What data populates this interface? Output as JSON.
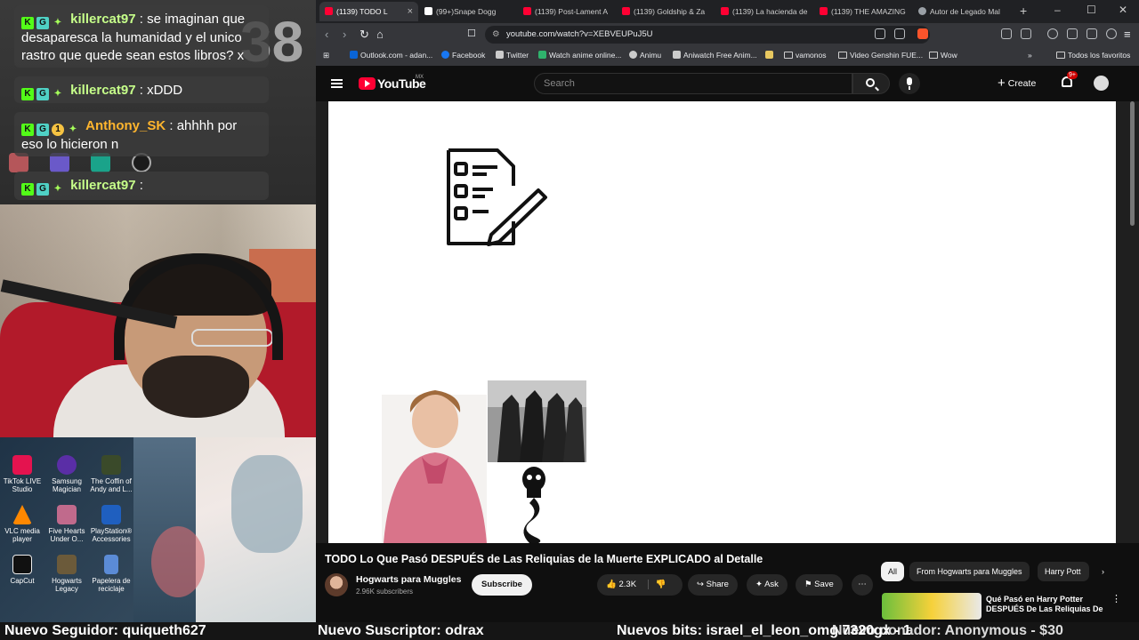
{
  "stream": {
    "chat": [
      {
        "user": "killercat97",
        "message": "se imaginan que desaparesca la humanidad y el unico rastro que quede sean estos libros? x"
      },
      {
        "user": "killercat97",
        "message": "xDDD"
      },
      {
        "user": "Anthony_SK",
        "message": "ahhhh por eso lo hicieron n"
      },
      {
        "user": "killercat97",
        "message": ""
      }
    ],
    "clock_digits": "38",
    "desktop_icons": [
      {
        "label": "TikTok LIVE Studio",
        "color": "#e4134f"
      },
      {
        "label": "Samsung Magician",
        "color": "#5a2ea6"
      },
      {
        "label": "The Coffin of Andy and L...",
        "color": "#3a4a2a"
      },
      {
        "label": "VLC media player",
        "color": "#ff8800"
      },
      {
        "label": "Five Hearts Under O...",
        "color": "#c06a8c"
      },
      {
        "label": "PlayStation® Accessories",
        "color": "#1f5fbf"
      },
      {
        "label": "CapCut",
        "color": "#111111"
      },
      {
        "label": "Hogwarts Legacy",
        "color": "#6b5a3a"
      },
      {
        "label": "Papelera de reciclaje",
        "color": "#5b8bd6"
      }
    ]
  },
  "browser": {
    "tabs": [
      {
        "title": "(1139) TODO L",
        "color": "#ff0033"
      },
      {
        "title": "(99+)Snape Dogg",
        "color": "#ffffff"
      },
      {
        "title": "(1139) Post-Lament A",
        "color": "#ff0033"
      },
      {
        "title": "(1139) Goldship & Za",
        "color": "#ff0033"
      },
      {
        "title": "(1139) La hacienda de",
        "color": "#ff0033"
      },
      {
        "title": "(1139) THE AMAZING",
        "color": "#ff0033"
      },
      {
        "title": "Autor de Legado Mal",
        "color": "#9aa0a6"
      }
    ],
    "url": "youtube.com/watch?v=XEBVEUPuJ5U",
    "bookmarks": [
      {
        "label": "Outlook.com - adan...",
        "color": "#0a64d6"
      },
      {
        "label": "Facebook",
        "color": "#1877f2"
      },
      {
        "label": "Twitter",
        "color": "#cccccc"
      },
      {
        "label": "Watch anime online...",
        "color": "#2fb36d"
      },
      {
        "label": "Animu",
        "color": "#cccccc"
      },
      {
        "label": "Aniwatch Free Anim...",
        "color": "#cccccc"
      },
      {
        "label": "vamonos",
        "color": "folder"
      },
      {
        "label": "Video Genshin FUE...",
        "color": "folder"
      },
      {
        "label": "Wow",
        "color": "folder"
      }
    ],
    "all_bookmarks": "Todos los favoritos"
  },
  "youtube": {
    "logo_text": "YouTube",
    "region": "MX",
    "search_placeholder": "Search",
    "create_label": "Create",
    "notifications": "9+",
    "video_title": "TODO Lo Que Pasó DESPUÉS de Las Reliquias de la Muerte EXPLICADO al Detalle",
    "channel_name": "Hogwarts para Muggles",
    "subscribers": "2.96K subscribers",
    "subscribe_label": "Subscribe",
    "likes": "2.3K",
    "share_label": "Share",
    "ask_label": "Ask",
    "save_label": "Save",
    "chips": [
      "All",
      "From Hogwarts para Muggles",
      "Harry Pott"
    ],
    "recommended_title": "Qué Pasó en Harry Potter DESPUÉS De Las Reliquias De"
  },
  "ticker": {
    "follower": "Nuevo Seguidor: quiqueth627",
    "subscriber": "Nuevo Suscriptor: odrax",
    "bits": "Nuevos bits: israel_el_leon_omg 7320gx - 1",
    "donor": "Nuevo donador: Anonymous - $30"
  }
}
